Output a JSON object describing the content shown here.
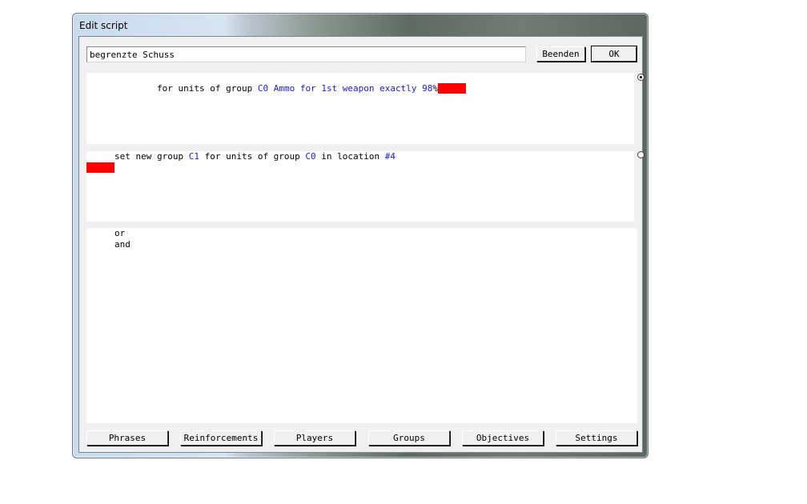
{
  "window": {
    "title": "Edit script"
  },
  "header": {
    "script_name": "begrenzte Schuss",
    "end_label": "Beenden",
    "ok_label": "OK"
  },
  "conditions": [
    {
      "parts": [
        {
          "t": "for units of group ",
          "c": "text"
        },
        {
          "t": "C0",
          "c": "kw"
        },
        {
          "t": " ",
          "c": "text"
        },
        {
          "t": "Ammo",
          "c": "kw"
        },
        {
          "t": " ",
          "c": "text"
        },
        {
          "t": "for 1st weapon",
          "c": "kw"
        },
        {
          "t": " ",
          "c": "text"
        },
        {
          "t": "exactly",
          "c": "kw"
        },
        {
          "t": " ",
          "c": "text"
        },
        {
          "t": "98",
          "c": "kw"
        },
        {
          "t": "%",
          "c": "text"
        }
      ],
      "selected": true
    },
    {
      "parts": [
        {
          "t": "set new group ",
          "c": "text"
        },
        {
          "t": "C1",
          "c": "kw"
        },
        {
          "t": " for units of group ",
          "c": "text"
        },
        {
          "t": "C0",
          "c": "kw"
        },
        {
          "t": " in location ",
          "c": "text"
        },
        {
          "t": "#4",
          "c": "kw"
        }
      ],
      "selected": false
    }
  ],
  "operators": [
    "or",
    "and"
  ],
  "toolbar": {
    "phrases": "Phrases",
    "reinforcements": "Reinforcements",
    "players": "Players",
    "groups": "Groups",
    "objectives": "Objectives",
    "settings": "Settings"
  },
  "colors": {
    "keyword": "#1b1bd6",
    "marker": "#ff0000",
    "titlebar": "#c9dbee"
  }
}
